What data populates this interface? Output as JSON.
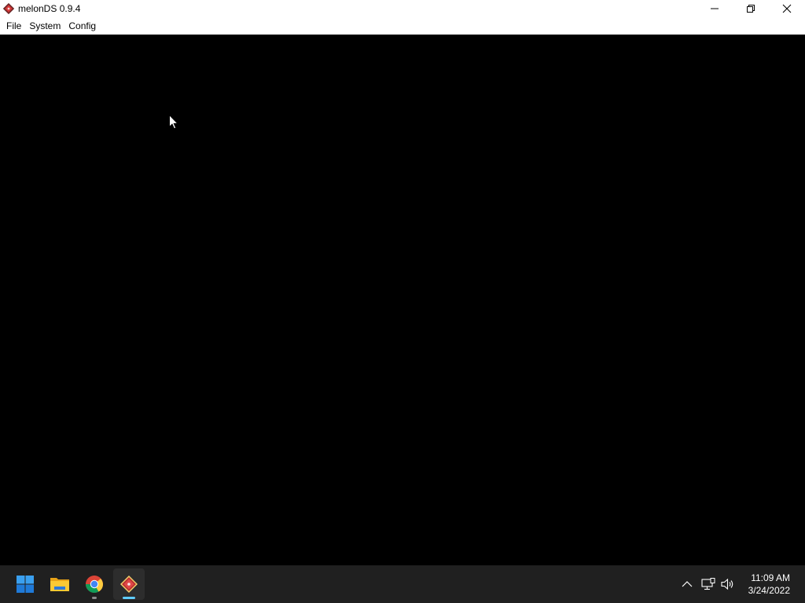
{
  "window": {
    "title": "melonDS 0.9.4",
    "controls": {
      "minimize": "minimize-icon",
      "maximize": "restore-icon",
      "close": "close-icon"
    }
  },
  "menubar": {
    "items": [
      {
        "label": "File"
      },
      {
        "label": "System"
      },
      {
        "label": "Config"
      }
    ]
  },
  "taskbar": {
    "apps": [
      {
        "icon": "windows-start-icon",
        "active": false
      },
      {
        "icon": "file-explorer-icon",
        "active": false
      },
      {
        "icon": "chrome-icon",
        "active": false,
        "running": true
      },
      {
        "icon": "melonds-icon",
        "active": true,
        "running": true
      }
    ],
    "tray": {
      "icons": [
        "chevron-up-icon",
        "network-icon",
        "volume-icon"
      ]
    },
    "clock": {
      "time": "11:09 AM",
      "date": "3/24/2022"
    }
  },
  "colors": {
    "taskbar_bg": "#202020",
    "screen_bg": "#000000",
    "titlebar_bg": "#ffffff",
    "accent": "#60cdff"
  }
}
